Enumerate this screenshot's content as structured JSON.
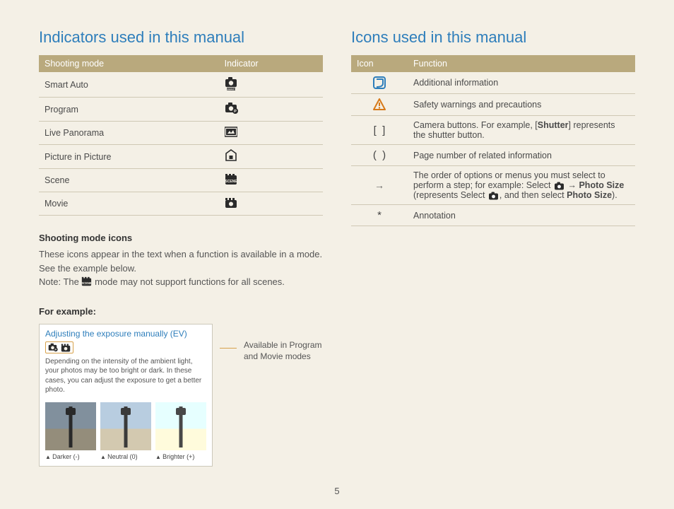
{
  "page_number": "5",
  "left": {
    "title": "Indicators used in this manual",
    "table": {
      "headers": [
        "Shooting mode",
        "Indicator"
      ],
      "rows": [
        {
          "name": "Smart Auto",
          "icon": "smart-auto-icon"
        },
        {
          "name": "Program",
          "icon": "program-icon"
        },
        {
          "name": "Live Panorama",
          "icon": "panorama-icon"
        },
        {
          "name": "Picture in Picture",
          "icon": "pip-icon"
        },
        {
          "name": "Scene",
          "icon": "scene-icon"
        },
        {
          "name": "Movie",
          "icon": "movie-icon"
        }
      ]
    },
    "sub1_title": "Shooting mode icons",
    "sub1_text_a": "These icons appear in the text when a function is available in a mode. See the example below.",
    "sub1_text_b_prefix": "Note: The ",
    "sub1_text_b_suffix": " mode may not support functions for all scenes.",
    "example_label": "For example:",
    "example": {
      "title": "Adjusting the exposure manually (EV)",
      "body": "Depending on the intensity of the ambient light, your photos may be too bright or dark. In these cases, you can adjust the exposure to get a better photo.",
      "thumbs": [
        "Darker (-)",
        "Neutral (0)",
        "Brighter (+)"
      ]
    },
    "callout": "Available in Program and Movie modes"
  },
  "right": {
    "title": "Icons used in this manual",
    "table": {
      "headers": [
        "Icon",
        "Function"
      ],
      "rows": [
        {
          "icon": "note-icon",
          "text": "Additional information"
        },
        {
          "icon": "warning-icon",
          "text": "Safety warnings and precautions"
        },
        {
          "icon": "brackets-icon",
          "prefix": "Camera buttons. For example, [",
          "bold": "Shutter",
          "suffix": "] represents the shutter button."
        },
        {
          "icon": "parens-icon",
          "text": "Page number of related information"
        },
        {
          "icon": "arrow-icon",
          "prefix": "The order of options or menus you must select to perform a step; for example: Select ",
          "mid_icon": "camera-tiny-icon",
          "arrow": " → ",
          "bold": "Photo Size",
          "paren_open": " (represents Select ",
          "mid_icon2": "camera-tiny-icon",
          "paren_mid": ", and then select ",
          "bold2": "Photo Size",
          "paren_close": ")."
        },
        {
          "icon": "asterisk-icon",
          "text": "Annotation"
        }
      ]
    }
  }
}
